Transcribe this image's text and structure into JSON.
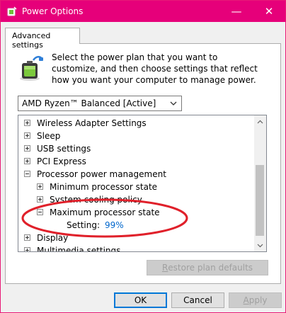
{
  "window": {
    "title": "Power Options",
    "controls": {
      "minimize": "—",
      "close": "✕"
    }
  },
  "tabs": [
    {
      "label": "Advanced settings",
      "active": true
    }
  ],
  "description": "Select the power plan that you want to customize, and then choose settings that reflect how you want your computer to manage power.",
  "plan_select": {
    "value": "AMD Ryzen™ Balanced [Active]"
  },
  "tree": {
    "items": [
      {
        "label": "Wireless Adapter Settings",
        "expander": "plus",
        "level": 0
      },
      {
        "label": "Sleep",
        "expander": "plus",
        "level": 0
      },
      {
        "label": "USB settings",
        "expander": "plus",
        "level": 0
      },
      {
        "label": "PCI Express",
        "expander": "plus",
        "level": 0
      },
      {
        "label": "Processor power management",
        "expander": "minus",
        "level": 0
      },
      {
        "label": "Minimum processor state",
        "expander": "plus",
        "level": 1
      },
      {
        "label": "System cooling policy",
        "expander": "plus",
        "level": 1
      },
      {
        "label": "Maximum processor state",
        "expander": "minus",
        "level": 1
      },
      {
        "label": "Setting:",
        "value": "99%",
        "level": 2
      },
      {
        "label": "Display",
        "expander": "plus",
        "level": 0
      },
      {
        "label": "Multimedia settings",
        "expander": "plus",
        "level": 0
      }
    ]
  },
  "buttons": {
    "restore": {
      "accel": "R",
      "rest": "estore plan defaults"
    },
    "ok": "OK",
    "cancel": "Cancel",
    "apply": {
      "accel": "A",
      "rest": "pply"
    }
  },
  "colors": {
    "titlebar": "#e6007a",
    "annotation": "#e0202a",
    "setting_value": "#0066cc"
  }
}
